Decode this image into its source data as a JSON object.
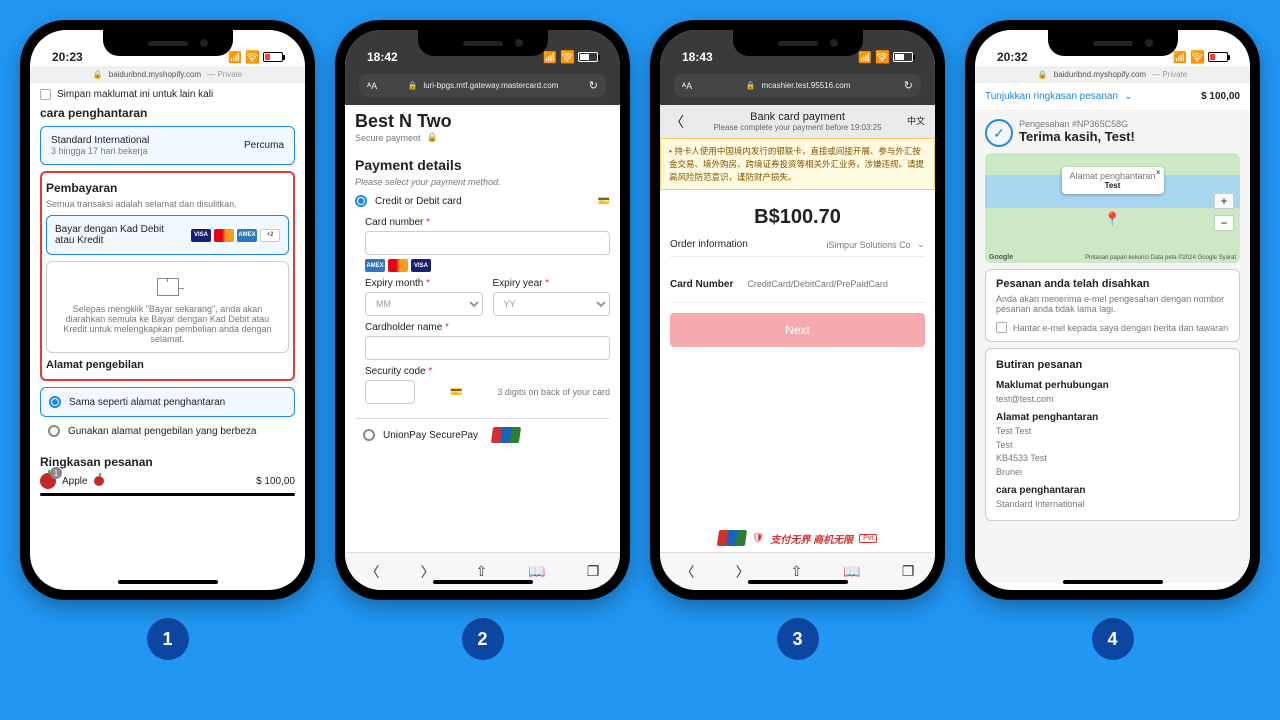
{
  "steps": [
    "1",
    "2",
    "3",
    "4"
  ],
  "p1": {
    "time": "20:23",
    "url": "baiduribnd.myshopify.com",
    "url_suffix": "— Private",
    "save_info": "Simpan maklumat ini untuk lain kali",
    "ship_title": "cara penghantaran",
    "ship_name": "Standard International",
    "ship_eta": "3 hingga 17 hari bekerja",
    "ship_price": "Percuma",
    "pay_title": "Pembayaran",
    "pay_sub": "Semua transaksi adalah selamat dan disulitkan.",
    "pay_opt": "Bayar dengan Kad Debit atau Kredit",
    "pay_more": "+2",
    "redirect_note": "Selepas mengklik \"Bayar sekarang\", anda akan diarahkan semula ke Bayar dengan Kad Debit atau Kredit untuk melengkapkan pembelian anda dengan selamat.",
    "billing_title": "Alamat pengebilan",
    "billing_same": "Sama seperti alamat penghantaran",
    "billing_diff": "Gunakan alamat pengebilan yang berbeza",
    "summary_title": "Ringkasan pesanan",
    "item_name": "Apple",
    "item_qty": "1",
    "item_price": "$ 100,00"
  },
  "p2": {
    "time": "18:42",
    "url": "luri-bpgs.mtf.gateway.mastercard.com",
    "store": "Best N Two",
    "secure": "Secure payment",
    "heading": "Payment details",
    "method_prompt": "Please select your payment method.",
    "method1": "Credit or Debit card",
    "card_num": "Card number",
    "exp_m": "Expiry month",
    "exp_y": "Expiry year",
    "mm": "MM",
    "yy": "YY",
    "holder": "Cardholder name",
    "cvv": "Security code",
    "cvv_hint": "3 digits on back of your card",
    "method2": "UnionPay SecurePay"
  },
  "p3": {
    "time": "18:43",
    "url": "mcashier.test.95516.com",
    "title": "Bank card payment",
    "subtitle": "Please complete your payment before 19:03:25",
    "lang": "中文",
    "warning": "持卡人使用中国境内发行的银联卡，直接或间接开展、参与外汇按金交易、境外购房、跨境证券投资等相关外汇业务，涉嫌违规。请提高风险防范意识，谨防财产损失。",
    "amount": "B$100.70",
    "order_info_label": "Order information",
    "order_info_value": "iSimpur Solutions Co",
    "card_label": "Card Number",
    "card_placeholder": "CreditCard/DebitCard/PrePaidCard",
    "next": "Next",
    "brand": "支付无界  商机无限",
    "pvt": "Pvt"
  },
  "p4": {
    "time": "20:32",
    "url": "baiduribnd.myshopify.com",
    "url_suffix": "— Private",
    "show_summary": "Tunjukkan ringkasan pesanan",
    "total": "$ 100,00",
    "order_meta": "Pengesahan #NP365C58G",
    "thanks": "Terima kasih, Test!",
    "map_label": "Alamat penghantaran",
    "map_value": "Test",
    "google": "Google",
    "map_attrib": "Pintasan papan kekunci   Data peta ©2024 Google   Syarat",
    "confirmed_title": "Pesanan anda telah disahkan",
    "confirmed_body": "Anda akan menerima e-mel pengesahan dengan nombor pesanan anda tidak lama lagi.",
    "email_opt": "Hantar e-mel kepada saya dengan berita dan tawaran",
    "details_title": "Butiran pesanan",
    "contact_title": "Maklumat perhubungan",
    "contact_email": "test@test.com",
    "ship_addr_title": "Alamat penghantaran",
    "addr1": "Test Test",
    "addr2": "Test",
    "addr3": "KB4533 Test",
    "addr4": "Brunei",
    "method_title": "cara penghantaran",
    "method_value": "Standard International"
  }
}
